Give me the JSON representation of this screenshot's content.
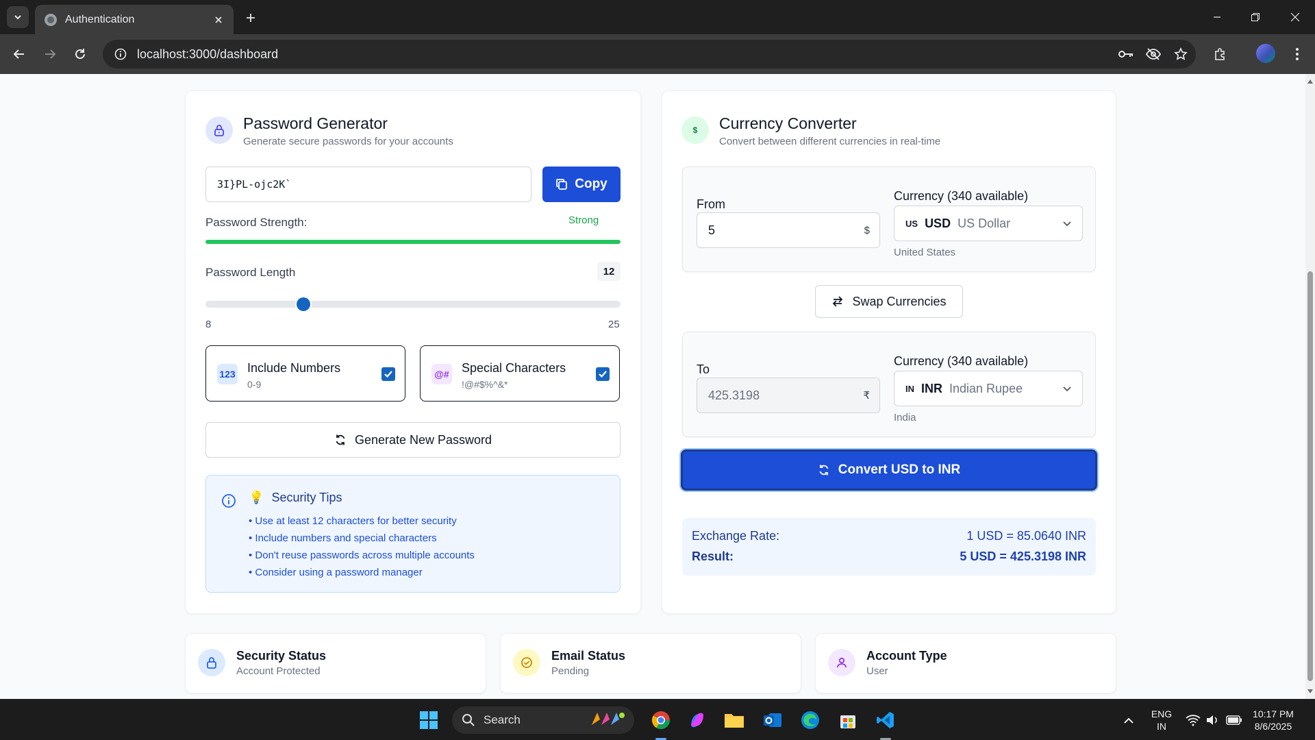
{
  "browser": {
    "tab_title": "Authentication",
    "url": "localhost:3000/dashboard"
  },
  "password_generator": {
    "title": "Password Generator",
    "subtitle": "Generate secure passwords for your accounts",
    "password": "3I}PL-ojc2K`",
    "copy_label": "Copy",
    "strength_label": "Password Strength:",
    "strength_value": "Strong",
    "strength_fraction": 1.0,
    "length_label": "Password Length",
    "length_value": "12",
    "length_min": "8",
    "length_max": "25",
    "slider_value": 12,
    "option_numbers": {
      "icon_text": "123",
      "title": "Include Numbers",
      "sub": "0-9",
      "checked": true
    },
    "option_special": {
      "icon_text": "@#",
      "title": "Special Characters",
      "sub": "!@#$%^&*",
      "checked": true
    },
    "generate_label": "Generate New Password",
    "tips": {
      "emoji": "💡",
      "title": "Security Tips",
      "items": [
        "• Use at least 12 characters for better security",
        "• Include numbers and special characters",
        "• Don't reuse passwords across multiple accounts",
        "• Consider using a password manager"
      ]
    }
  },
  "currency_converter": {
    "icon_text": "$",
    "title": "Currency Converter",
    "subtitle": "Convert between different currencies in real-time",
    "from": {
      "label": "From",
      "amount": "5",
      "symbol": "$",
      "currency_label": "Currency (340 available)",
      "flag": "US",
      "code": "USD",
      "name": "US Dollar",
      "country": "United States"
    },
    "swap_label": "Swap Currencies",
    "to": {
      "label": "To",
      "amount": "425.3198",
      "symbol": "₹",
      "currency_label": "Currency (340 available)",
      "flag": "IN",
      "code": "INR",
      "name": "Indian Rupee",
      "country": "India"
    },
    "convert_label": "Convert USD to INR",
    "exchange_rate_label": "Exchange Rate:",
    "exchange_rate_value": "1 USD = 85.0640 INR",
    "result_label": "Result:",
    "result_value": "5 USD = 425.3198 INR"
  },
  "status_cards": [
    {
      "title": "Security Status",
      "sub": "Account Protected",
      "color": "#dbeafe",
      "icon": "lock-icon"
    },
    {
      "title": "Email Status",
      "sub": "Pending",
      "color": "#fef9c3",
      "icon": "check-circle-icon"
    },
    {
      "title": "Account Type",
      "sub": "User",
      "color": "#f3e8ff",
      "icon": "user-icon"
    }
  ],
  "taskbar": {
    "search_placeholder": "Search",
    "lang_line1": "ENG",
    "lang_line2": "IN",
    "time": "10:17 PM",
    "date": "8/6/2025"
  },
  "colors": {
    "primary": "#1d4ed8",
    "success": "#22c55e",
    "tips_bg": "#eff6ff"
  }
}
